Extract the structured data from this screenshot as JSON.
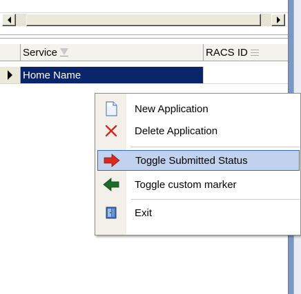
{
  "scrollbar": {
    "left_arrow": "scroll-left",
    "right_arrow": "scroll-right"
  },
  "grid": {
    "columns": [
      {
        "label": "Service",
        "icon": "sort-icon"
      },
      {
        "label": "RACS ID",
        "icon": "filter-icon"
      }
    ],
    "rows": [
      {
        "service": "Home Name",
        "racs_id": ""
      }
    ],
    "selection_color": "#0a246a"
  },
  "context_menu": {
    "items": [
      {
        "label": "New Application",
        "icon": "new-document-icon"
      },
      {
        "label": "Delete Application",
        "icon": "delete-x-icon"
      },
      {
        "label": "Toggle Submitted Status",
        "icon": "red-arrow-icon",
        "highlighted": true
      },
      {
        "label": "Toggle custom marker",
        "icon": "green-arrow-icon"
      },
      {
        "label": "Exit",
        "icon": "exit-door-icon"
      }
    ],
    "highlight_color": "#c1d2ee"
  }
}
